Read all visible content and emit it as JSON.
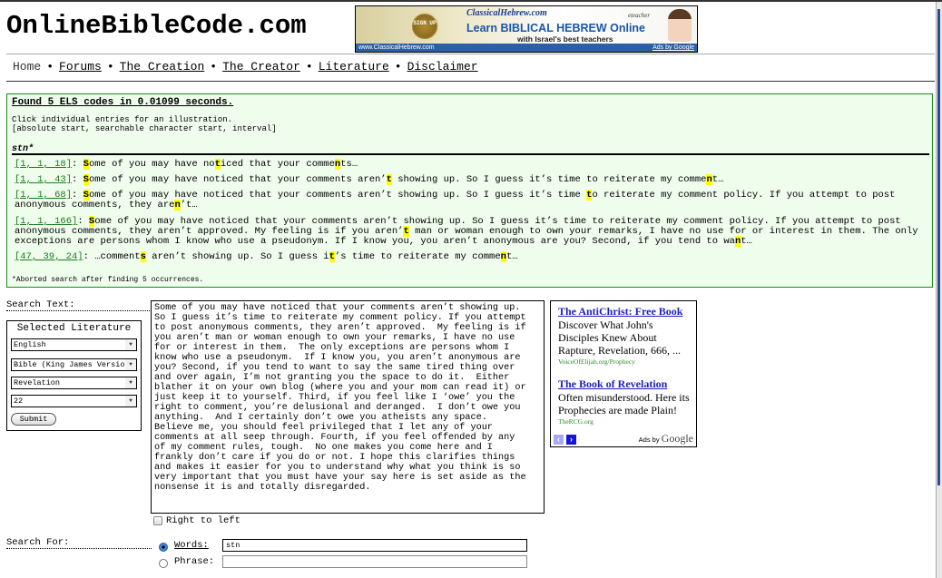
{
  "site": {
    "logo": "OnlineBibleCode.com"
  },
  "banner_ad": {
    "brand": "ClassicalHebrew.com",
    "headline": "Learn BIBLICAL HEBREW Online",
    "subline": "with Israel's best teachers",
    "seal": "SIGN UP",
    "partner": "eteacher",
    "url": "www.ClassicalHebrew.com",
    "ads_by": "Ads by Google"
  },
  "nav": {
    "items": [
      {
        "label": "Home"
      },
      {
        "label": "Forums"
      },
      {
        "label": "The Creation"
      },
      {
        "label": "The Creator"
      },
      {
        "label": "Literature"
      },
      {
        "label": "Disclaimer"
      }
    ],
    "separator": "•"
  },
  "results": {
    "summary": "Found 5 ELS codes in 0.01099 seconds.",
    "hint_line1": "Click individual entries for an illustration.",
    "hint_line2": "[absolute start, searchable character start, interval]",
    "term": "stn*",
    "entries": [
      {
        "coords": "[1, 1, 18]",
        "parts": [
          "",
          "S",
          "ome of you may have no",
          "t",
          "iced that your comme",
          "n",
          "ts…"
        ]
      },
      {
        "coords": "[1, 1, 43]",
        "parts": [
          "",
          "S",
          "ome of you may have noticed that your comments aren’",
          "t",
          " showing up. So I guess it’s time to reiterate my comme",
          "n",
          "t…"
        ]
      },
      {
        "coords": "[1, 1, 68]",
        "parts": [
          "",
          "S",
          "ome of you may have noticed that your comments aren’t showing up. So I guess it’s time ",
          "t",
          "o reiterate my comment policy. If you attempt to post anonymous comments, they are",
          "n",
          "’t…"
        ]
      },
      {
        "coords": "[1, 1, 166]",
        "parts": [
          "",
          "S",
          "ome of you may have noticed that your comments aren’t showing up. So I guess it’s time to reiterate my comment policy. If you attempt to post anonymous comments, they aren’t approved. My feeling is if you aren’",
          "t",
          " man or woman enough to own your remarks, I have no use for or interest in them. The only exceptions are persons whom I know who use a pseudonym. If I know you, you aren’t anonymous are you? Second, if you tend to wa",
          "n",
          "t…"
        ]
      },
      {
        "coords": "[47, 39, 24]",
        "parts": [
          "…comment",
          "s",
          " aren’t showing up. So I guess i",
          "t",
          "’s time to reiterate my comme",
          "n",
          "t…"
        ]
      }
    ],
    "note": "*Aborted search after finding 5 occurrences.",
    "highlight_color": "#ffff00",
    "link_color": "#1a7a1a",
    "panel_bg": "#effded",
    "panel_border": "#1a8c1a"
  },
  "form": {
    "search_text_label": "Search Text:",
    "literature": {
      "title": "Selected Literature",
      "language": "English",
      "book_collection": "Bible (King James Version)",
      "book": "Revelation",
      "chapter": "22",
      "submit_label": "Submit"
    },
    "search_text_value": "Some of you may have noticed that your comments aren’t showing up.\nSo I guess it’s time to reiterate my comment policy. If you attempt\nto post anonymous comments, they aren’t approved.  My feeling is if\nyou aren’t man or woman enough to own your remarks, I have no use\nfor or interest in them.  The only exceptions are persons whom I\nknow who use a pseudonym.  If I know you, you aren’t anonymous are\nyou? Second, if you tend to want to say the same tired thing over\nand over again, I’m not granting you the space to do it.  Either\nblather it on your own blog (where you and your mom can read it) or\njust keep it to yourself. Third, if you feel like I ‘owe’ you the\nright to comment, you’re delusional and deranged.  I don’t owe you\nanything.  And I certainly don’t owe you atheists any space.\nBelieve me, you should feel privileged that I let any of your\ncomments at all seep through. Fourth, if you feel offended by any\nof my comment rules, tough.  No one makes you come here and I\nfrankly don’t care if you do or not. I hope this clarifies things\nand makes it easier for you to understand why what you think is so\nvery important that you must have your say here is set aside as the\nnonsense it is and totally disregarded.",
    "right_to_left_label": "Right to left",
    "right_to_left_checked": false,
    "search_for_label": "Search For:",
    "words_label": "Words:",
    "words_value": "stn",
    "words_selected": true,
    "phrase_label": "Phrase:",
    "phrase_value": ""
  },
  "side_ads": {
    "items": [
      {
        "title": "The AntiChrist: Free Book",
        "desc": "Discover What John's Disciples Knew About Rapture, Revelation, 666, ...",
        "url": "VoiceOfElijah.org/Prophecy"
      },
      {
        "title": "The Book of Revelation",
        "desc": "Often misunderstood. Here its Prophecies are made Plain!",
        "url": "TheRCG.org"
      }
    ],
    "prev_icon": "‹",
    "next_icon": "›",
    "ads_by": "Ads by",
    "google": "Google"
  }
}
